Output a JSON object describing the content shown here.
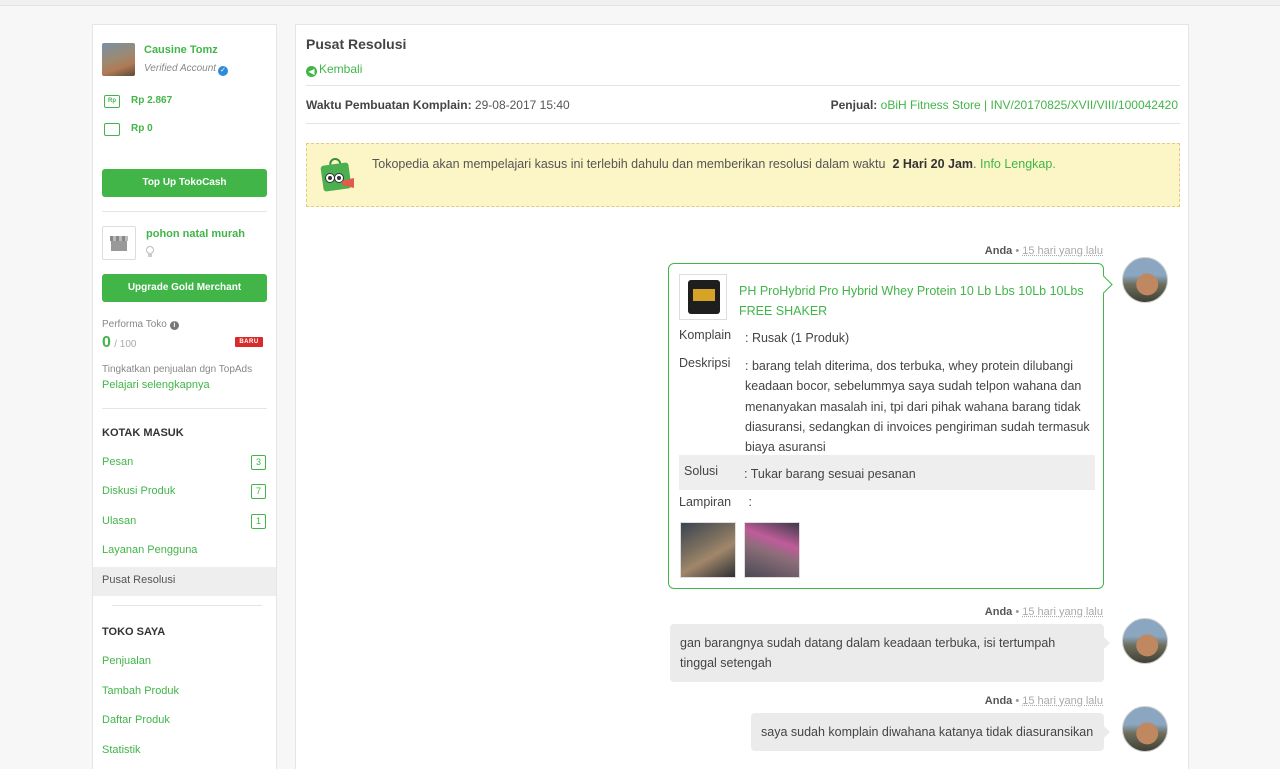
{
  "user": {
    "name": "Causine Tomz",
    "verified": "Verified Account",
    "balance1": "Rp 2.867",
    "balance2": "Rp 0",
    "topup": "Top Up TokoCash"
  },
  "shop": {
    "name": "pohon natal murah",
    "upgrade": "Upgrade Gold Merchant",
    "performa_label": "Performa Toko",
    "performa_value": "0",
    "performa_max": "/ 100",
    "baru": "BARU",
    "topads_text": "Tingkatkan penjualan dgn TopAds",
    "topads_link": "Pelajari selengkapnya"
  },
  "inbox": {
    "title": "KOTAK MASUK",
    "items": [
      {
        "label": "Pesan",
        "count": "3"
      },
      {
        "label": "Diskusi Produk",
        "count": "7"
      },
      {
        "label": "Ulasan",
        "count": "1"
      },
      {
        "label": "Layanan Pengguna"
      },
      {
        "label": "Pusat Resolusi"
      }
    ]
  },
  "toko": {
    "title": "TOKO SAYA",
    "items": [
      {
        "label": "Penjualan"
      },
      {
        "label": "Tambah Produk"
      },
      {
        "label": "Daftar Produk"
      },
      {
        "label": "Statistik"
      }
    ]
  },
  "main": {
    "title": "Pusat Resolusi",
    "back": "Kembali",
    "complain_time_label": "Waktu Pembuatan Komplain:",
    "complain_time": "29-08-2017 15:40",
    "seller_label": "Penjual:",
    "seller_store": "oBiH Fitness Store",
    "seller_sep": "|",
    "invoice": "INV/20170825/XVII/VIII/100042420"
  },
  "notice": {
    "text": "Tokopedia akan mempelajari kasus ini terlebih dahulu dan memberikan resolusi dalam waktu",
    "duration": "2 Hari 20 Jam",
    "end": ".",
    "link": "Info Lengkap",
    "link_end": "."
  },
  "messages": {
    "sender": "Anda",
    "time": "15 hari yang lalu",
    "product": "PH ProHybrid Pro Hybrid Whey Protein 10 Lb Lbs 10Lb 10Lbs FREE SHAKER",
    "komplain_label": "Komplain",
    "komplain": ": Rusak (1 Produk)",
    "deskripsi_label": "Deskripsi",
    "deskripsi": ": barang telah diterima, dos terbuka, whey protein dilubangi keadaan bocor, sebelummya saya sudah telpon wahana dan menanyakan masalah ini, tpi dari pihak wahana barang tidak diasuransi, sedangkan di invoices pengiriman sudah termasuk biaya asuransi",
    "solusi_label": "Solusi",
    "solusi": ": Tukar barang sesuai pesanan",
    "lampiran_label": "Lampiran",
    "lampiran_colon": ":",
    "msg2": "gan barangnya sudah datang dalam keadaan terbuka, isi tertumpah tinggal setengah",
    "msg3": "saya sudah komplain diwahana katanya tidak diasuransikan"
  },
  "colors": {
    "accent": "#42b549",
    "notice_bg": "#fcf6c6",
    "badge_red": "#d82c2c"
  }
}
